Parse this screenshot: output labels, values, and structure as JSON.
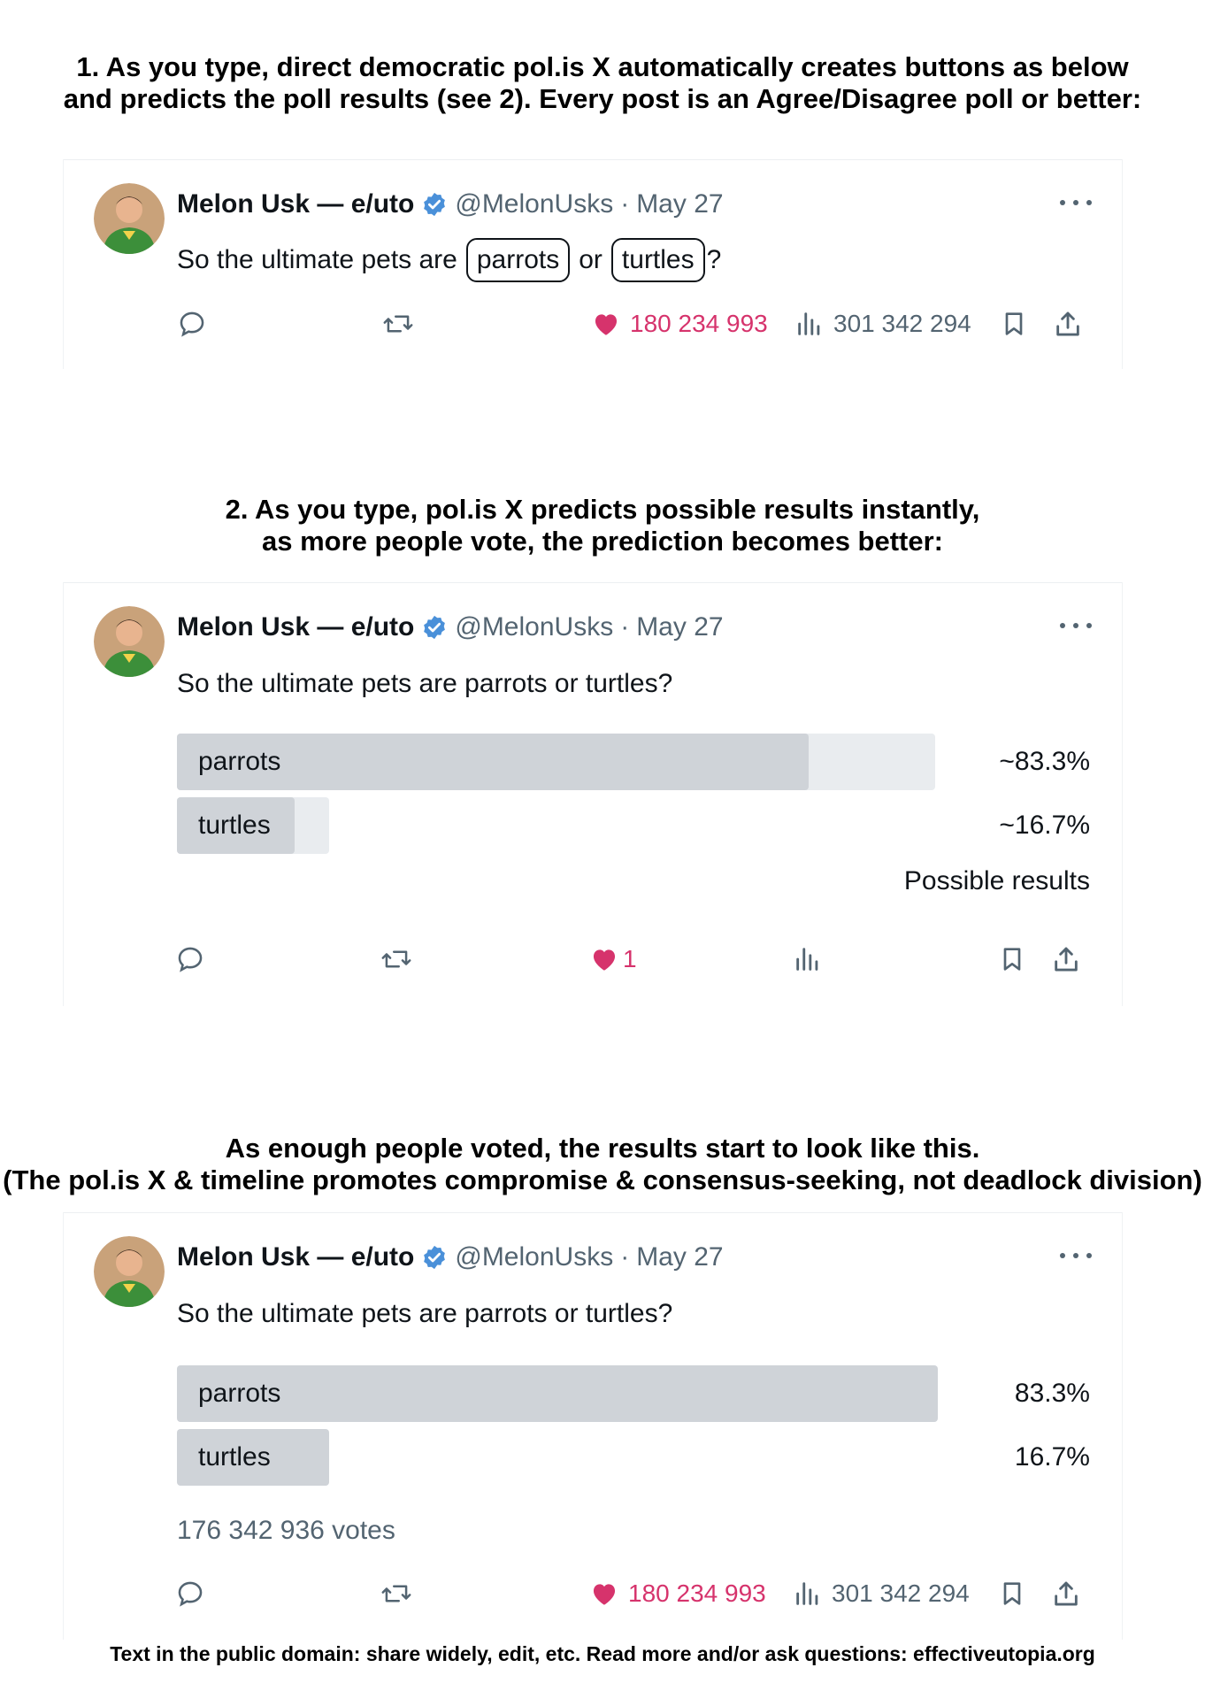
{
  "section1": {
    "heading_line1": "1. As you type, direct democratic pol.is X automatically creates buttons as below",
    "heading_line2": "and predicts the poll results (see 2). Every post is an Agree/Disagree poll or better:"
  },
  "section2": {
    "heading_line1": "2. As you type, pol.is X predicts possible results instantly,",
    "heading_line2": "as more people vote, the prediction becomes better:"
  },
  "section3": {
    "heading_line1": "As enough people voted, the results start to look like this.",
    "heading_line2": "(The pol.is X & timeline promotes compromise & consensus-seeking, not deadlock division)"
  },
  "post": {
    "author_name": "Melon Usk — e/uto",
    "handle": "@MelonUsks",
    "separator": "·",
    "date": "May 27",
    "text": "So the ultimate pets are parrots or turtles?",
    "text_prefix": "So the ultimate pets are",
    "chip_parrots": "parrots",
    "text_or": "or",
    "chip_turtles": "turtles",
    "text_suffix": "?"
  },
  "tweet1": {
    "likes": "180 234 993",
    "views": "301 342 294"
  },
  "tweet2": {
    "options": [
      {
        "label": "parrots",
        "percent_text": "~83.3%",
        "fill": 0.833
      },
      {
        "label": "turtles",
        "percent_text": "~16.7%",
        "fill": 0.167
      }
    ],
    "note": "Possible results",
    "likes": "1"
  },
  "tweet3": {
    "options": [
      {
        "label": "parrots",
        "percent_text": "83.3%",
        "fill": 0.833
      },
      {
        "label": "turtles",
        "percent_text": "16.7%",
        "fill": 0.167
      }
    ],
    "votes": "176 342 936 votes",
    "likes": "180 234 993",
    "views": "301 342 294"
  },
  "footer": "Text in the public domain: share widely, edit, etc. Read more and/or ask questions: effectiveutopia.org",
  "icons": {
    "reply": "reply-icon",
    "retweet": "retweet-icon",
    "like": "heart-icon",
    "views": "views-icon",
    "bookmark": "bookmark-icon",
    "share": "share-icon",
    "verified": "verified-badge-icon",
    "more": "more-icon"
  },
  "colors": {
    "like": "#d6336c",
    "verified": "#4a90d9",
    "muted": "#536471",
    "poll_fill": "#cfd3d8",
    "poll_bg": "#e9ecef"
  }
}
